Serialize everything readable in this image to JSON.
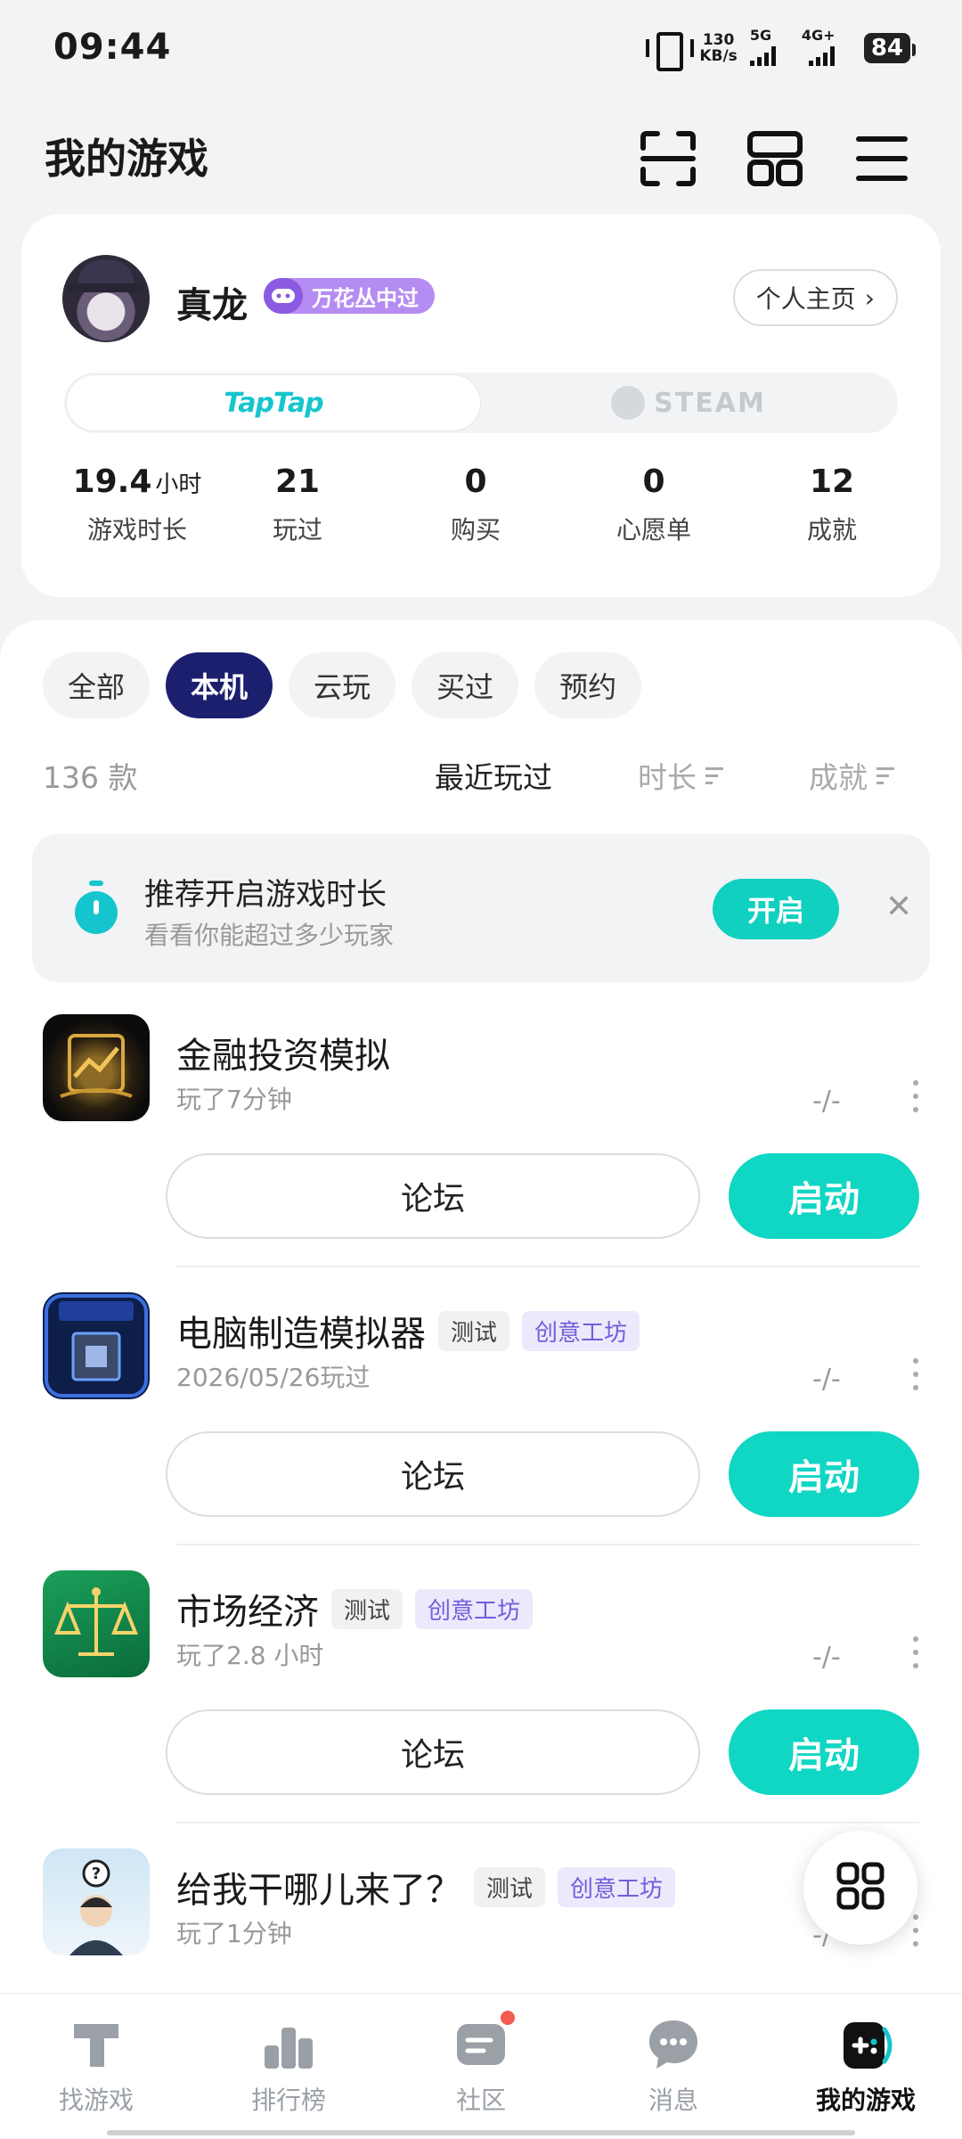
{
  "status_bar": {
    "time": "09:44",
    "speed_value": "130",
    "speed_unit": "KB/s",
    "net1": "5G",
    "net2": "4G+",
    "battery": "84"
  },
  "header": {
    "title": "我的游戏",
    "icons": [
      "scan-icon",
      "grid-layout-icon",
      "menu-icon"
    ]
  },
  "profile": {
    "name": "真龙",
    "badge": "万花丛中过",
    "home_button": "个人主页",
    "platforms": [
      "TapTap",
      "STEAM"
    ],
    "stats": [
      {
        "value": "19.4",
        "unit": "小时",
        "label": "游戏时长"
      },
      {
        "value": "21",
        "unit": "",
        "label": "玩过"
      },
      {
        "value": "0",
        "unit": "",
        "label": "购买"
      },
      {
        "value": "0",
        "unit": "",
        "label": "心愿单"
      },
      {
        "value": "12",
        "unit": "",
        "label": "成就"
      }
    ]
  },
  "filters": [
    "全部",
    "本机",
    "云玩",
    "买过",
    "预约"
  ],
  "active_filter": "本机",
  "sort": {
    "count": "136 款",
    "options": [
      "最近玩过",
      "时长",
      "成就"
    ]
  },
  "tip": {
    "title": "推荐开启游戏时长",
    "subtitle": "看看你能超过多少玩家",
    "button": "开启"
  },
  "games": [
    {
      "name": "金融投资模拟",
      "tags": [],
      "sub": "玩了7分钟",
      "rating": "-/-",
      "forum": "论坛",
      "launch": "启动"
    },
    {
      "name": "电脑制造模拟器",
      "tags": [
        "测试",
        "创意工坊"
      ],
      "sub": "2026/05/26玩过",
      "rating": "-/-",
      "forum": "论坛",
      "launch": "启动"
    },
    {
      "name": "市场经济",
      "tags": [
        "测试",
        "创意工坊"
      ],
      "sub": "玩了2.8 小时",
      "rating": "-/-",
      "forum": "论坛",
      "launch": "启动"
    },
    {
      "name": "给我干哪儿来了？",
      "tags": [
        "测试",
        "创意工坊"
      ],
      "sub": "玩了1分钟",
      "rating": "-/-"
    }
  ],
  "bottom_nav": [
    "找游戏",
    "排行榜",
    "社区",
    "消息",
    "我的游戏"
  ],
  "colors": {
    "accent": "#10d6c4",
    "active_chip": "#1b1f6e",
    "workshop_tag": "#6f5fd9"
  }
}
